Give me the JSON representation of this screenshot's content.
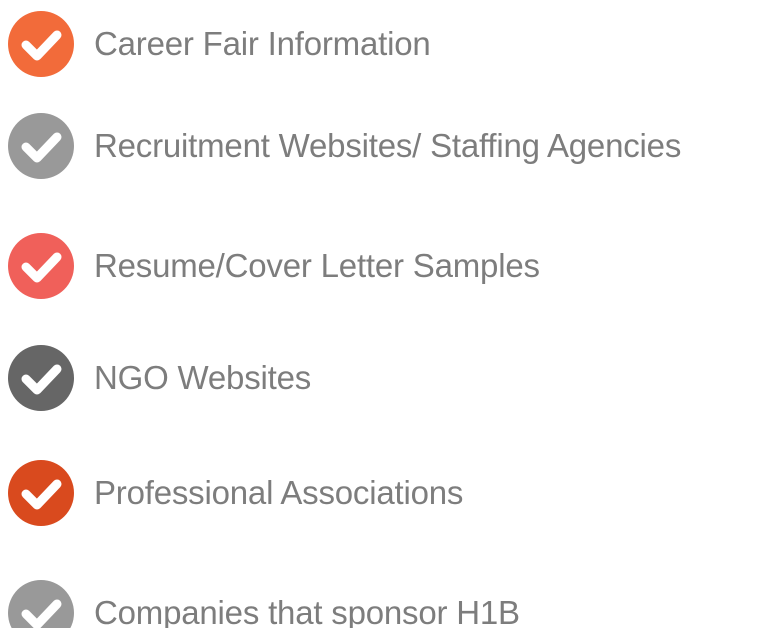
{
  "items": [
    {
      "label": "Career Fair Information",
      "icon": "check-circle-icon",
      "color": "#f26b3a"
    },
    {
      "label": "Recruitment Websites/ Staffing Agencies",
      "icon": "check-circle-icon",
      "color": "#999999"
    },
    {
      "label": "Resume/Cover Letter Samples",
      "icon": "check-circle-icon",
      "color": "#f0605a"
    },
    {
      "label": "NGO Websites",
      "icon": "check-circle-icon",
      "color": "#666666"
    },
    {
      "label": "Professional Associations",
      "icon": "check-circle-icon",
      "color": "#d94a1e"
    },
    {
      "label": "Companies that sponsor H1B",
      "icon": "check-circle-icon",
      "color": "#999999"
    }
  ]
}
